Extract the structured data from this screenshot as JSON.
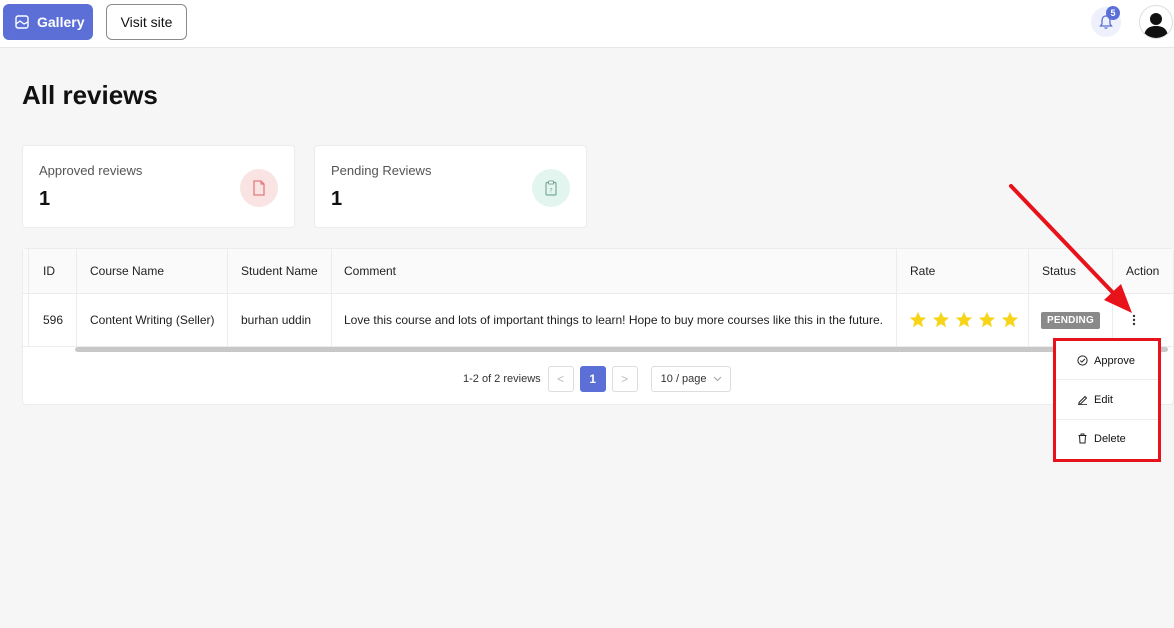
{
  "topbar": {
    "gallery_label": "Gallery",
    "visit_label": "Visit site",
    "notification_count": "5"
  },
  "page": {
    "title": "All reviews"
  },
  "stats": [
    {
      "label": "Approved reviews",
      "value": "1",
      "color": "#f9e3e3",
      "icon": "document-icon"
    },
    {
      "label": "Pending Reviews",
      "value": "1",
      "color": "#e2f5ee",
      "icon": "clipboard-question-icon"
    }
  ],
  "table": {
    "columns": [
      "ID",
      "Course Name",
      "Student Name",
      "Comment",
      "Rate",
      "Status",
      "Action"
    ],
    "rows": [
      {
        "id": "596",
        "course": "Content Writing (Seller)",
        "student": "burhan uddin",
        "comment": "Love this course and lots of important things to learn! Hope to buy more courses like this in the future.",
        "rating": 5,
        "status": "PENDING"
      }
    ]
  },
  "pagination": {
    "summary": "1-2 of 2 reviews",
    "prev": "<",
    "current": "1",
    "next": ">",
    "page_size": "10 / page"
  },
  "action_menu": {
    "items": [
      "Approve",
      "Edit",
      "Delete"
    ]
  },
  "colors": {
    "accent": "#5b6fd6",
    "star": "#f7d417",
    "annotation": "#e8121b"
  }
}
